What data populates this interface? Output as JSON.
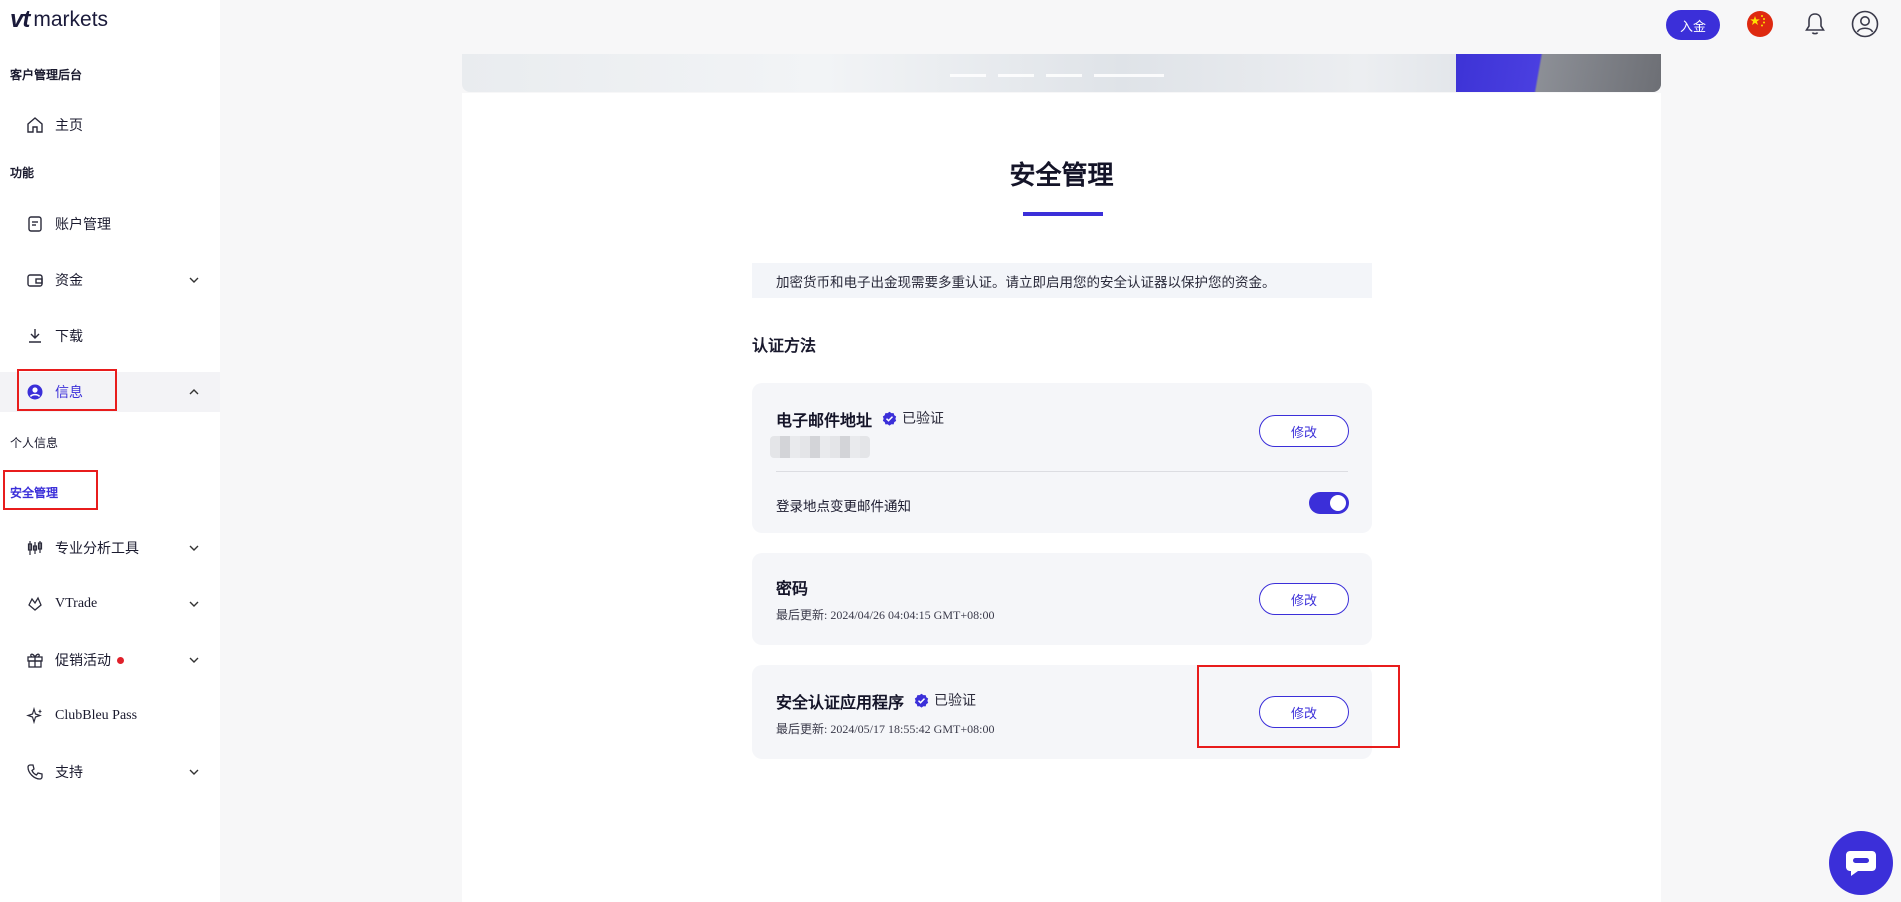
{
  "brand": {
    "bold": "vt",
    "rest": "markets"
  },
  "sidebar": {
    "section_client": "客户管理后台",
    "section_functions": "功能",
    "home": "主页",
    "account": "账户管理",
    "funds": "资金",
    "download": "下载",
    "info": "信息",
    "personal_info": "个人信息",
    "security": "安全管理",
    "analysis_tools": "专业分析工具",
    "vtrade": "VTrade",
    "promotions": "促销活动",
    "clubbleu": "ClubBleu Pass",
    "support": "支持"
  },
  "header": {
    "deposit_label": "入金"
  },
  "main": {
    "title": "安全管理",
    "notice": "加密货币和电子出金现需要多重认证。请立即启用您的安全认证器以保护您的资金。",
    "methods_title": "认证方法",
    "email": {
      "title": "电子邮件地址",
      "status": "已验证",
      "edit_label": "修改",
      "notify_label": "登录地点变更邮件通知",
      "notify_on": true
    },
    "password": {
      "title": "密码",
      "updated": "最后更新: 2024/04/26 04:04:15 GMT+08:00",
      "edit_label": "修改"
    },
    "authenticator": {
      "title": "安全认证应用程序",
      "status": "已验证",
      "updated": "最后更新: 2024/05/17 18:55:42 GMT+08:00",
      "edit_label": "修改"
    }
  },
  "colors": {
    "accent": "#3b2fd9",
    "highlight": "#e81c1c",
    "alert_dot": "#e0202a"
  }
}
